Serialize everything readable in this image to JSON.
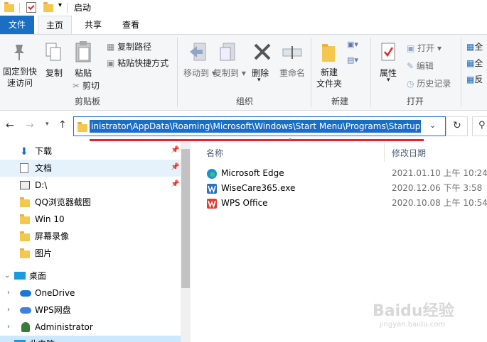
{
  "window": {
    "title": "启动"
  },
  "tabs": [
    {
      "label": "文件"
    },
    {
      "label": "主页"
    },
    {
      "label": "共享"
    },
    {
      "label": "查看"
    }
  ],
  "ribbon": {
    "pin_quick": "固定到快\n速访问",
    "copy": "复制",
    "paste": "粘贴",
    "copy_path": "复制路径",
    "paste_shortcut": "粘贴快捷方式",
    "cut": "剪切",
    "clipboard_group": "剪贴板",
    "move_to": "移动到",
    "copy_to": "复制到",
    "delete": "删除",
    "rename": "重命名",
    "organize_group": "组织",
    "new_folder": "新建\n文件夹",
    "new_group": "新建",
    "properties": "属性",
    "open": "打开",
    "edit": "编辑",
    "history": "历史记录",
    "open_group": "打开",
    "select_all_1": "全",
    "select_all_2": "全",
    "select_all_3": "反"
  },
  "address": {
    "path": "inistrator\\AppData\\Roaming\\Microsoft\\Windows\\Start Menu\\Programs\\Startup"
  },
  "nav": {
    "items": [
      {
        "label": "下载",
        "icon": "download-arrow-icon",
        "pinned": true
      },
      {
        "label": "文档",
        "icon": "document-icon",
        "pinned": true
      },
      {
        "label": "D:\\",
        "icon": "drive-icon",
        "pinned": true
      },
      {
        "label": "QQ浏览器截图",
        "icon": "folder-icon"
      },
      {
        "label": "Win 10",
        "icon": "folder-icon"
      },
      {
        "label": "屏幕录像",
        "icon": "folder-icon"
      },
      {
        "label": "图片",
        "icon": "folder-icon"
      },
      {
        "label": "桌面",
        "icon": "desktop-icon"
      },
      {
        "label": "OneDrive",
        "icon": "cloud-icon"
      },
      {
        "label": "WPS网盘",
        "icon": "cloud-icon"
      },
      {
        "label": "Administrator",
        "icon": "user-icon"
      },
      {
        "label": "此电脑",
        "icon": "computer-icon"
      }
    ]
  },
  "list": {
    "columns": [
      "名称",
      "修改日期"
    ],
    "rows": [
      {
        "name": "Microsoft Edge",
        "date": "2021.01.10 上午 10:24",
        "icon": "edge-icon"
      },
      {
        "name": "WiseCare365.exe",
        "date": "2020.12.06 下午 3:58",
        "icon": "wisecare-icon"
      },
      {
        "name": "WPS Office",
        "date": "2020.10.08 上午 10:54",
        "icon": "wps-icon"
      }
    ]
  },
  "watermark": {
    "text": "Baidu经验",
    "sub": "jingyan.baidu.com"
  },
  "colors": {
    "accent": "#1a6fc4",
    "selection": "#e5f1fb",
    "underline": "#e3262a"
  }
}
